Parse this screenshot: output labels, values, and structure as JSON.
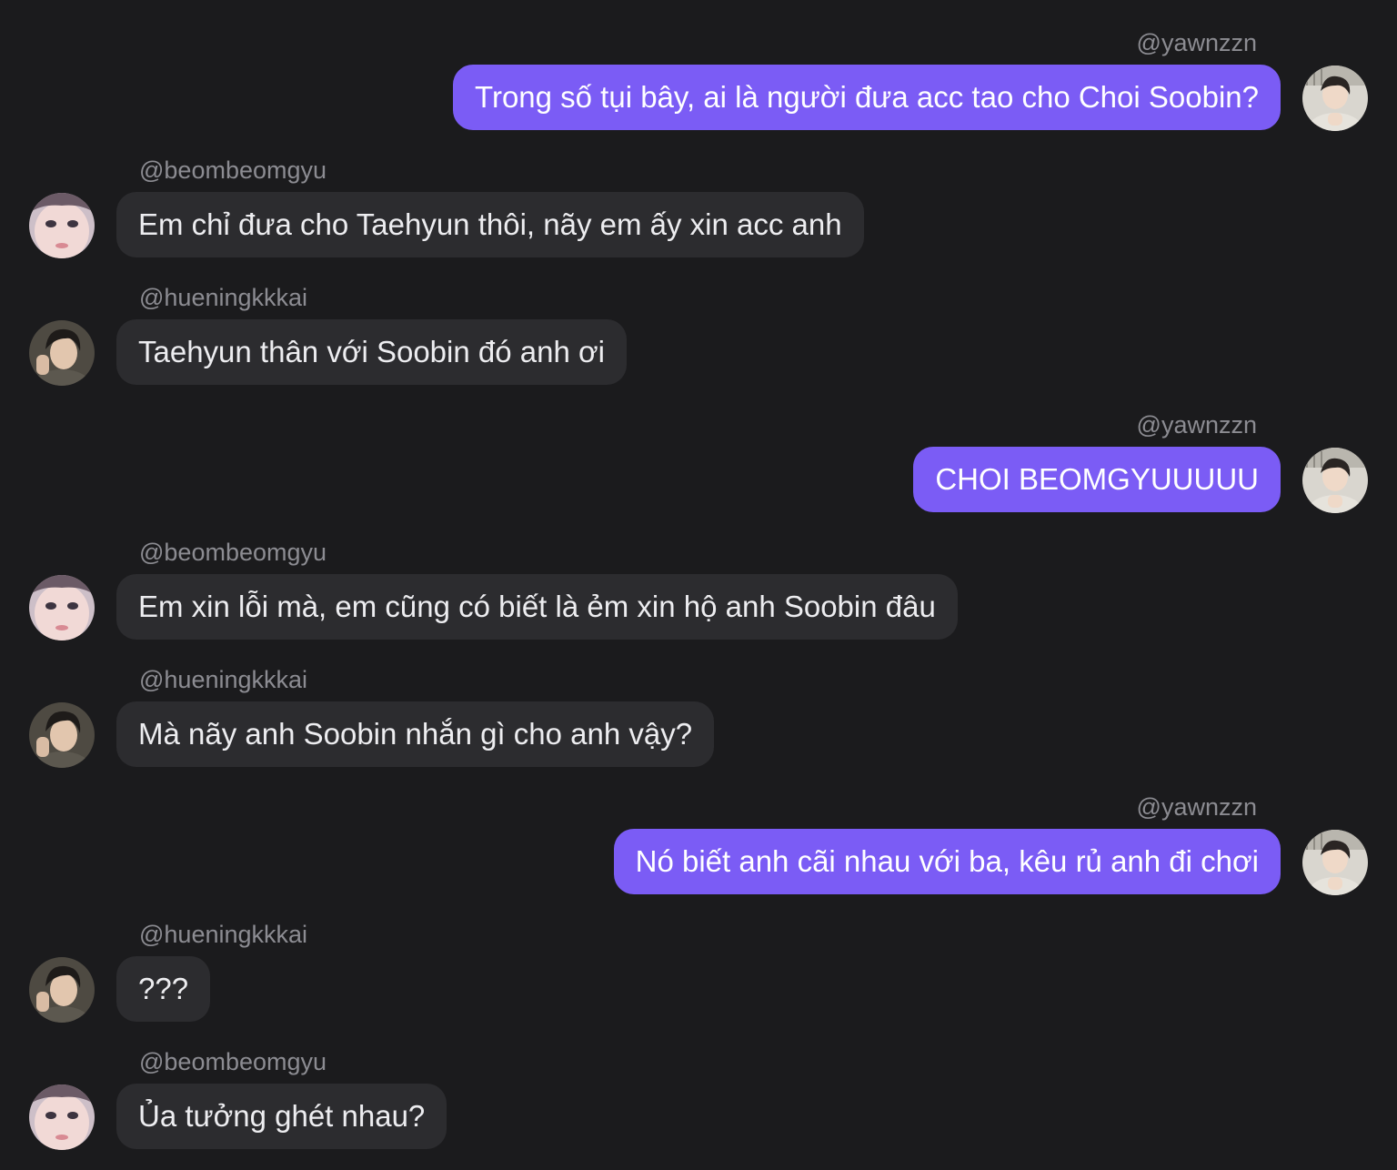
{
  "colors": {
    "background": "#1b1b1d",
    "outgoing_bubble": "#7b5cf5",
    "incoming_bubble": "#2c2c2f",
    "username_text": "#8c8c92",
    "incoming_text": "#ededf0",
    "outgoing_text": "#ffffff"
  },
  "messages": [
    {
      "direction": "out",
      "username": "@yawnzzn",
      "text": "Trong số tụi bây, ai là người đưa acc tao cho Choi Soobin?",
      "avatar": "avatar-yawnzzn"
    },
    {
      "direction": "in",
      "username": "@beombeomgyu",
      "text": "Em chỉ đưa cho Taehyun thôi, nãy em ấy xin acc anh",
      "avatar": "avatar-beombeomgyu"
    },
    {
      "direction": "in",
      "username": "@hueningkkkai",
      "text": "Taehyun thân với Soobin đó anh ơi",
      "avatar": "avatar-hueningkkkai"
    },
    {
      "direction": "out",
      "username": "@yawnzzn",
      "text": "CHOI BEOMGYUUUUU",
      "avatar": "avatar-yawnzzn"
    },
    {
      "direction": "in",
      "username": "@beombeomgyu",
      "text": "Em xin lỗi mà, em cũng có biết là ẻm xin hộ anh Soobin đâu",
      "avatar": "avatar-beombeomgyu"
    },
    {
      "direction": "in",
      "username": "@hueningkkkai",
      "text": "Mà nãy anh Soobin nhắn gì cho anh vậy?",
      "avatar": "avatar-hueningkkkai"
    },
    {
      "direction": "out",
      "username": "@yawnzzn",
      "text": "Nó biết anh cãi nhau với ba, kêu rủ anh đi chơi",
      "avatar": "avatar-yawnzzn"
    },
    {
      "direction": "in",
      "username": "@hueningkkkai",
      "text": "???",
      "avatar": "avatar-hueningkkkai"
    },
    {
      "direction": "in",
      "username": "@beombeomgyu",
      "text": "Ủa tưởng ghét nhau?",
      "avatar": "avatar-beombeomgyu"
    }
  ]
}
